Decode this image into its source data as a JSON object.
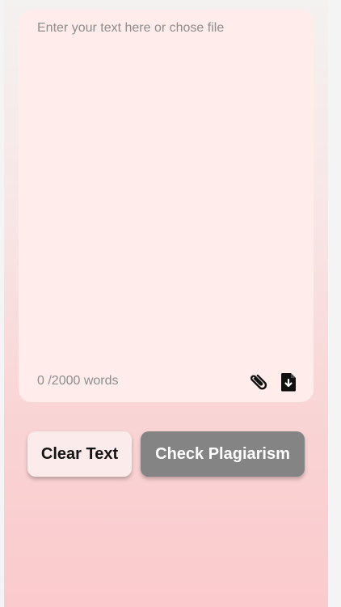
{
  "editor": {
    "placeholder": "Enter your text here or chose file",
    "value": "",
    "word_count": "0 /2000 words"
  },
  "icons": {
    "attach": "paperclip-icon",
    "download": "file-download-icon"
  },
  "actions": {
    "clear_label": "Clear Text",
    "check_label": "Check Plagiarism"
  },
  "colors": {
    "card_background": "#ffeceb",
    "clear_button": "#fbeceb",
    "check_button": "#848484",
    "gradient_bottom": "#fbcacc"
  }
}
